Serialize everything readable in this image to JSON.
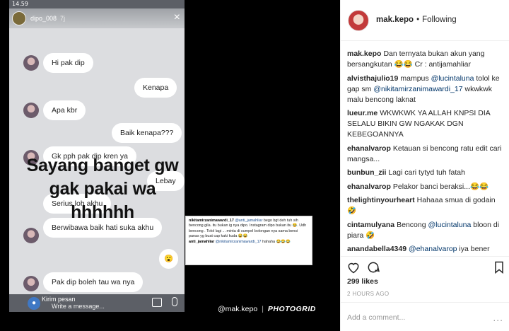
{
  "phone": {
    "status_time": "14.59",
    "story_user": "dipo_008",
    "story_time": "7j",
    "bubbles": [
      "Hi pak dip",
      "Kenapa",
      "Apa kbr",
      "Baik kenapa???",
      "Gk pph pak dip kren ya",
      "Lebay",
      "Serius loh akhu",
      "Berwibawa baik hati suka akhu",
      "😮",
      "Pak dip boleh tau wa nya"
    ],
    "overlay": [
      "Sayang banget gw",
      "gak pakai wa",
      "hhhhhh"
    ],
    "composer_label": "Kirim pesan",
    "composer_placeholder": "Write a message..."
  },
  "comment_card": {
    "c1_user": "nikitamirzanimawardi_17",
    "c1_mention": "@anti_jamahliar",
    "c1_text": "bego bgt deh tuh sih bencong gila. itu bukan ig nya dipo. Instagram dipo bukan itu 😂. Udh bencong . Tolol lagi ... minta di sumpel bolongan nya sama bensi panas yg buat cap kaki kuda 😂😂",
    "c2_user": "anti_jamahliar",
    "c2_mention": "@nikitamirzanimawardi_17",
    "c2_text": "hahaha 😂😂😂"
  },
  "watermark": {
    "account": "@mak.kepo",
    "separator": "|",
    "brand": "PHOTOGRID"
  },
  "panel": {
    "username": "mak.kepo",
    "dot": "•",
    "follow_status": "Following",
    "comments": [
      {
        "user": "mak.kepo",
        "text": "Dan ternyata bukan akun yang bersangkutan 😂😂 Cr : antijamahliar"
      },
      {
        "user": "alvisthajulio19",
        "text": "mampus ",
        "mention": "@lucintaluna",
        "text2": " tolol ke gap sm ",
        "mention2": "@nikitamirzanimawardi_17",
        "text3": " wkwkwk malu bencong laknat"
      },
      {
        "user": "lueur.me",
        "text": "WKWKWK YA ALLAH KNPSI DIA SELALU BIKIN GW NGAKAK DGN KEBEGOANNYA"
      },
      {
        "user": "ehanalvarop",
        "text": "Ketauan si bencong ratu edit cari mangsa..."
      },
      {
        "user": "bunbun_zii",
        "text": "Lagi cari tytyd tuh fatah"
      },
      {
        "user": "ehanalvarop",
        "text": "Pelakor banci beraksi...😂😂"
      },
      {
        "user": "thelightinyourheart",
        "text": "Hahaaa smua di godain 🤣"
      },
      {
        "user": "cintamulyana",
        "text": "Bencong ",
        "mention": "@lucintaluna",
        "text2": " bloon di piara 🤣"
      },
      {
        "user": "anandabella4349",
        "text": "",
        "mention": "@ehanalvarop",
        "text2": " iya bener bgt, tiap foto mukanya beda terus, kalo g"
      }
    ],
    "likes": "299 likes",
    "time": "2 HOURS AGO",
    "add_comment_placeholder": "Add a comment...",
    "more": "..."
  }
}
